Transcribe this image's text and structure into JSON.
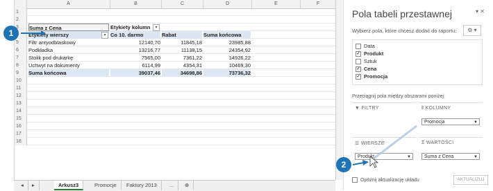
{
  "spreadsheet": {
    "columns": [
      "A",
      "B",
      "C",
      "D",
      "E",
      "F"
    ],
    "rows": [
      {
        "n": "1",
        "a": "",
        "b": "",
        "c": "",
        "d": ""
      },
      {
        "n": "2",
        "a": "",
        "b": "",
        "c": "",
        "d": ""
      },
      {
        "n": "3",
        "a": "Suma z Cena",
        "b": "Etykiety kolumn",
        "c": "",
        "d": ""
      },
      {
        "n": "4",
        "a": "Etykiety wierszy",
        "b": "Co 10. darmo",
        "c": "Rabat",
        "d": "Suma końcowa"
      },
      {
        "n": "5",
        "a": "Filtr antyodblaskowy",
        "b": "12140,70",
        "c": "11845,18",
        "d": "23985,88"
      },
      {
        "n": "6",
        "a": "Podkładka",
        "b": "13216,77",
        "c": "11138,15",
        "d": "24354,92"
      },
      {
        "n": "7",
        "a": "Stolik pod drukarkę",
        "b": "7565,00",
        "c": "7361,22",
        "d": "14926,22"
      },
      {
        "n": "8",
        "a": "Uchwyt na dokumenty",
        "b": "6114,99",
        "c": "4354,31",
        "d": "10469,30"
      },
      {
        "n": "9",
        "a": "Suma końcowa",
        "b": "39037,46",
        "c": "34698,86",
        "d": "73736,32"
      },
      {
        "n": "10"
      },
      {
        "n": "11"
      },
      {
        "n": "12"
      },
      {
        "n": "13"
      },
      {
        "n": "14"
      },
      {
        "n": "15"
      },
      {
        "n": "16"
      },
      {
        "n": "17"
      },
      {
        "n": "18"
      }
    ]
  },
  "sheet_tabs": [
    "Arkusz3",
    "Promocje",
    "Faktury 2013",
    "..."
  ],
  "pane": {
    "title": "Pola tabeli przestawnej",
    "subtitle": "Wybierz pola, które chcesz dodać do raportu:",
    "fields": [
      {
        "label": "Data",
        "checked": false
      },
      {
        "label": "Produkt",
        "checked": true
      },
      {
        "label": "Sztuk",
        "checked": false
      },
      {
        "label": "Cena",
        "checked": true
      },
      {
        "label": "Promocja",
        "checked": true
      }
    ],
    "drag_label": "Przeciągnij pola między obszarami poniżej:",
    "areas": {
      "filters": {
        "title": "FILTRY"
      },
      "columns": {
        "title": "KOLUMNY",
        "field": "Promocja"
      },
      "rows": {
        "title": "WIERSZE",
        "field": "Produkt"
      },
      "values": {
        "title": "WARTOŚCI",
        "field": "Suma z Cena"
      }
    },
    "defer_label": "Opóźnij aktualizację układu",
    "update_label": "AKTUALIZUJ"
  },
  "markers": [
    "1",
    "2"
  ]
}
